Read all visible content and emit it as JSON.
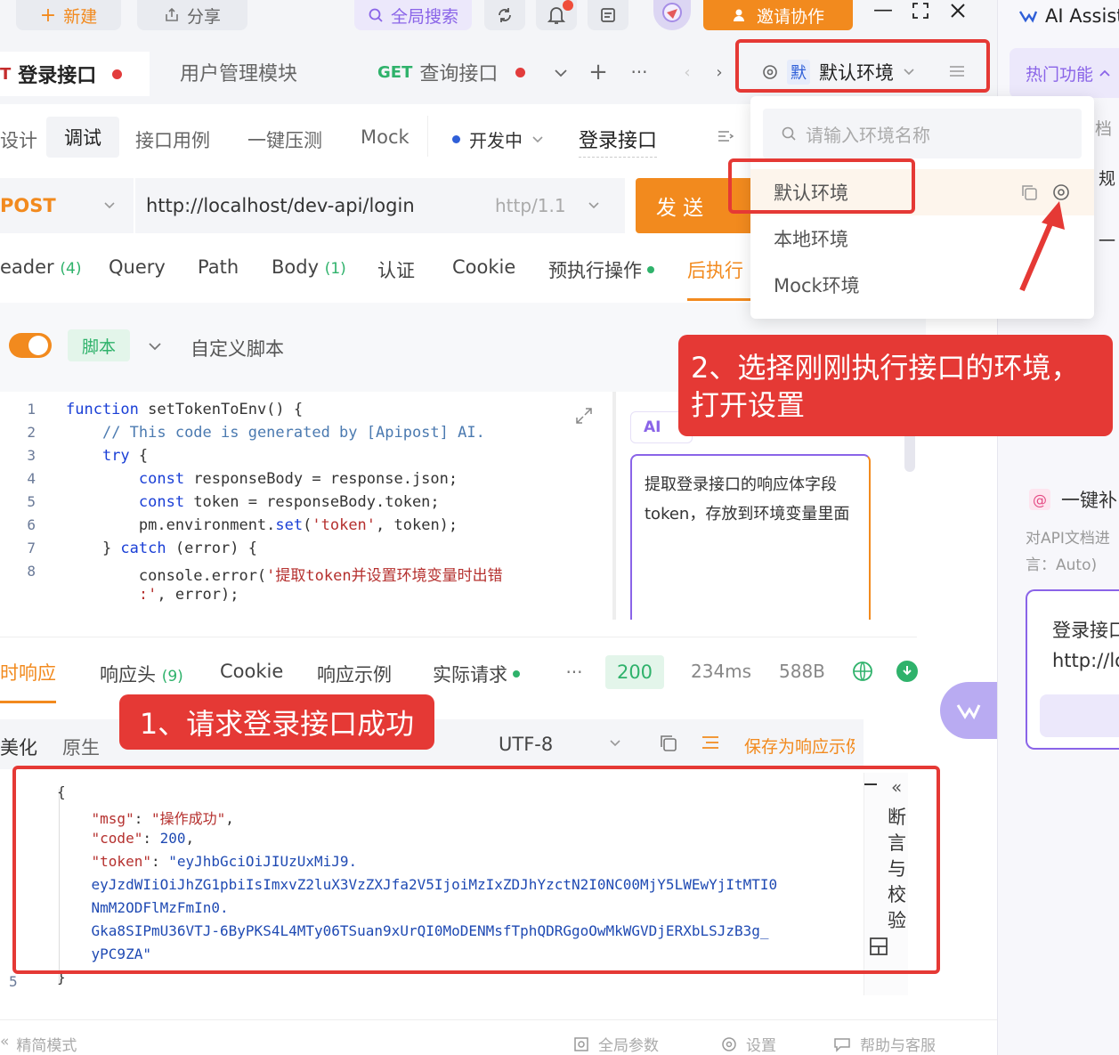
{
  "toolbar": {
    "new_label": "新建",
    "share_label": "分享",
    "search_label": "全局搜索",
    "invite_label": "邀请协作"
  },
  "tabs": [
    {
      "method": "",
      "label": "登录接口",
      "dot": true
    },
    {
      "method": "",
      "label": "用户管理模块",
      "dot": false
    },
    {
      "method": "GET",
      "label": "查询接口",
      "dot": true
    }
  ],
  "env": {
    "badge": "默",
    "current": "默认环境",
    "search_placeholder": "请输入环境名称",
    "items": [
      "默认环境",
      "本地环境",
      "Mock环境"
    ]
  },
  "subtabs": [
    "设计",
    "调试",
    "接口用例",
    "一键压测",
    "Mock"
  ],
  "status": "开发中",
  "api_name": "登录接口",
  "request": {
    "method": "POST",
    "url": "http://localhost/dev-api/login",
    "protocol": "http/1.1",
    "send_label": "发 送"
  },
  "param_tabs": [
    {
      "label": "eader",
      "count": "(4)"
    },
    {
      "label": "Query",
      "count": ""
    },
    {
      "label": "Path",
      "count": ""
    },
    {
      "label": "Body",
      "count": "(1)"
    },
    {
      "label": "认证",
      "count": ""
    },
    {
      "label": "Cookie",
      "count": ""
    },
    {
      "label": "预执行操作",
      "count": ""
    },
    {
      "label": "后执行",
      "count": ""
    }
  ],
  "script_bar": {
    "script_label": "脚本",
    "custom_label": "自定义脚本"
  },
  "code_lines": [
    {
      "n": "1",
      "html": "<span class=\"kw\">function</span> setTokenToEnv() {"
    },
    {
      "n": "2",
      "html": "    <span class=\"cm\">// This code is generated by [Apipost] AI.</span>"
    },
    {
      "n": "3",
      "html": "    <span class=\"kw\">try</span> {"
    },
    {
      "n": "4",
      "html": "        <span class=\"kw\">const</span> responseBody = response.json;"
    },
    {
      "n": "5",
      "html": "        <span class=\"kw\">const</span> token = responseBody.token;"
    },
    {
      "n": "6",
      "html": "        pm.environment.<span class=\"kw\">set</span>(<span class=\"st\">'token'</span>, token);"
    },
    {
      "n": "7",
      "html": "    } <span class=\"kw\">catch</span> (error) {"
    },
    {
      "n": "8",
      "html": "        console.error(<span class=\"st\">'提取token并设置环境变量时出错</span>"
    },
    {
      "n": "",
      "html": "        <span class=\"st\">:'</span>, error);"
    }
  ],
  "ai": {
    "tag": "AI",
    "prompt": "提取登录接口的响应体字段token，存放到环境变量里面"
  },
  "response_tabs": [
    {
      "label": "时响应",
      "count": ""
    },
    {
      "label": "响应头",
      "count": "(9)"
    },
    {
      "label": "Cookie",
      "count": ""
    },
    {
      "label": "响应示例",
      "count": ""
    },
    {
      "label": "实际请求",
      "count": ""
    }
  ],
  "response_meta": {
    "status": "200",
    "time": "234ms",
    "size": "588B"
  },
  "response_toolbar": {
    "beautify": "美化",
    "raw": "原生",
    "encoding": "UTF-8",
    "save_example": "保存为响应示例"
  },
  "json_lines": [
    "{",
    "    <span class=\"jk\">\"msg\"</span>: <span class=\"jk\">\"操作成功\"</span>,",
    "    <span class=\"jk\">\"code\"</span>: <span class=\"jv\">200</span>,",
    "    <span class=\"jk\">\"token\"</span>: <span class=\"jv\">\"eyJhbGciOiJIUzUxMiJ9.</span>",
    "    <span class=\"jv\">eyJzdWIiOiJhZG1pbiIsImxvZ2luX3VzZXJfa2V5IjoiMzIxZDJhYzctN2I0NC00MjY5LWEwYjItMTI0</span>",
    "    <span class=\"jv\">NmM2ODFlMzFmIn0.</span>",
    "    <span class=\"jv\">Gka8SIPmU36VTJ-6ByPKS4L4MTy06TSuan9xUrQI0MoDENMsfTphQDRGgoOwMkWGVDjERXbLSJzB3g_</span>",
    "    <span class=\"jv\">yPC9ZA\"</span>",
    "}"
  ],
  "assert_label": "断言与校验",
  "annotations": {
    "step1": "1、请求登录接口成功",
    "step2": "2、选择刚刚执行接口的环境，打开设置"
  },
  "right_panel": {
    "title": "AI Assist",
    "hot": "热门功能",
    "snippet1": "档",
    "snippet2": "规",
    "one_click": "一键补",
    "desc1": "对API文档进",
    "desc2": "言：Auto)",
    "card_title": "登录接口",
    "card_text": "http://lo"
  },
  "bottom_bar": {
    "simple_mode": "精简模式",
    "global_params": "全局参数",
    "settings": "设置",
    "help": "帮助与客服"
  },
  "colors": {
    "accent": "#f28a1e",
    "annotation_red": "#e53935",
    "success_green": "#2fb26b",
    "purple": "#8a64e8"
  }
}
